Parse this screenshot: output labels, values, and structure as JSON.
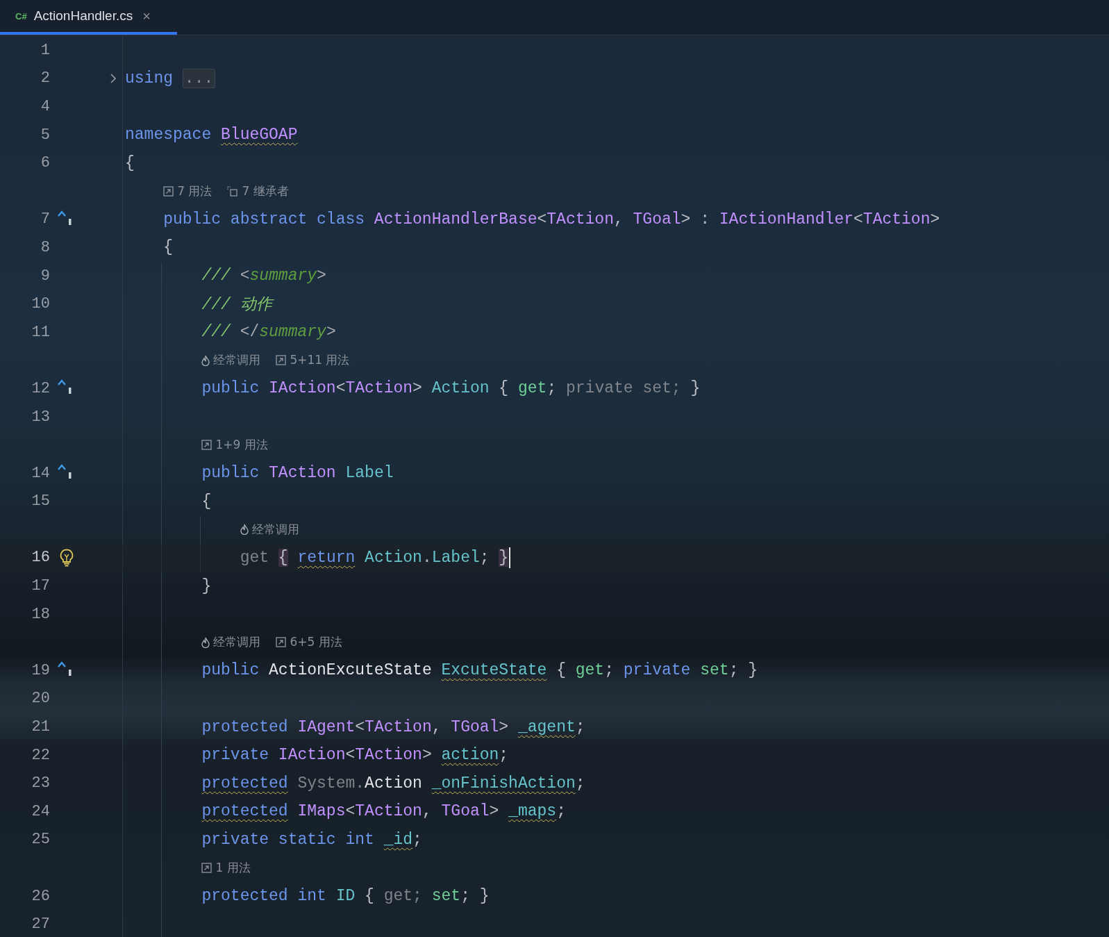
{
  "tab": {
    "badge": "C#",
    "label": "ActionHandler.cs",
    "close": "×",
    "selected": true
  },
  "lines": [
    {
      "number": "1",
      "current": false
    },
    {
      "number": "2",
      "current": false,
      "gutter": {
        "kind": "fold"
      },
      "tokens": [
        {
          "text": "using ",
          "kind": "kw"
        },
        {
          "text": "...",
          "kind": "folded"
        }
      ]
    },
    {
      "number": "4",
      "current": false
    },
    {
      "number": "5",
      "current": false,
      "tokens": [
        {
          "text": "namespace ",
          "kind": "kw"
        },
        {
          "text": "BlueGOAP",
          "kind": "type_warn"
        }
      ]
    },
    {
      "number": "6",
      "current": false,
      "tokens": [
        {
          "text": "{",
          "kind": "punct"
        }
      ]
    },
    {
      "number": "7",
      "current": false,
      "gutter": {
        "kind": "implements"
      },
      "hints": [
        {
          "kind": "usages",
          "text": "7 用法"
        },
        {
          "kind": "inheritors",
          "text": "7 继承者"
        }
      ],
      "tokens": [
        {
          "text": "    public abstract class ",
          "kind": "kw"
        },
        {
          "text": "ActionHandlerBase",
          "kind": "type"
        },
        {
          "text": "<",
          "kind": "punct"
        },
        {
          "text": "TAction",
          "kind": "type"
        },
        {
          "text": ", ",
          "kind": "punct"
        },
        {
          "text": "TGoal",
          "kind": "type"
        },
        {
          "text": "> : ",
          "kind": "punct"
        },
        {
          "text": "IActionHandler",
          "kind": "type"
        },
        {
          "text": "<",
          "kind": "punct"
        },
        {
          "text": "TAction",
          "kind": "type"
        },
        {
          "text": ">",
          "kind": "punct"
        }
      ]
    },
    {
      "number": "8",
      "current": false,
      "tokens": [
        {
          "text": "    {",
          "kind": "punct"
        }
      ]
    },
    {
      "number": "9",
      "current": false,
      "tokens": [
        {
          "text": "        /// ",
          "kind": "comment"
        },
        {
          "text": "<",
          "kind": "doc_bracket"
        },
        {
          "text": "summary",
          "kind": "doc_tag"
        },
        {
          "text": ">",
          "kind": "doc_bracket"
        }
      ]
    },
    {
      "number": "10",
      "current": false,
      "tokens": [
        {
          "text": "        /// 动作",
          "kind": "comment"
        }
      ]
    },
    {
      "number": "11",
      "current": false,
      "tokens": [
        {
          "text": "        /// ",
          "kind": "comment"
        },
        {
          "text": "</",
          "kind": "doc_bracket"
        },
        {
          "text": "summary",
          "kind": "doc_tag"
        },
        {
          "text": ">",
          "kind": "doc_bracket"
        }
      ]
    },
    {
      "number": "12",
      "current": false,
      "gutter": {
        "kind": "implements"
      },
      "hints": [
        {
          "kind": "hot",
          "text": "经常调用"
        },
        {
          "kind": "usages",
          "text": "5+11 用法"
        }
      ],
      "tokens": [
        {
          "text": "        public ",
          "kind": "kw"
        },
        {
          "text": "IAction",
          "kind": "type"
        },
        {
          "text": "<",
          "kind": "punct"
        },
        {
          "text": "TAction",
          "kind": "type"
        },
        {
          "text": "> ",
          "kind": "punct"
        },
        {
          "text": "Action",
          "kind": "prop"
        },
        {
          "text": " { ",
          "kind": "punct"
        },
        {
          "text": "get",
          "kind": "accessor"
        },
        {
          "text": "; ",
          "kind": "punct"
        },
        {
          "text": "private set;",
          "kind": "muted"
        },
        {
          "text": " }",
          "kind": "punct"
        }
      ]
    },
    {
      "number": "13",
      "current": false
    },
    {
      "number": "14",
      "current": false,
      "gutter": {
        "kind": "implements"
      },
      "hints": [
        {
          "kind": "usages",
          "text": "1+9 用法"
        }
      ],
      "tokens": [
        {
          "text": "        public ",
          "kind": "kw"
        },
        {
          "text": "TAction ",
          "kind": "type"
        },
        {
          "text": "Label",
          "kind": "prop"
        }
      ]
    },
    {
      "number": "15",
      "current": false,
      "tokens": [
        {
          "text": "        {",
          "kind": "punct"
        }
      ]
    },
    {
      "number": "16",
      "current": true,
      "gutter": {
        "kind": "bulb"
      },
      "hints": [
        {
          "kind": "hot",
          "text": "经常调用"
        }
      ],
      "tokens": [
        {
          "text": "            get ",
          "kind": "muted"
        },
        {
          "text": "{",
          "kind": "brace_match"
        },
        {
          "text": " return",
          "kind": "kw_warn"
        },
        {
          "text": " Action",
          "kind": "prop"
        },
        {
          "text": ".",
          "kind": "punct"
        },
        {
          "text": "Label",
          "kind": "prop"
        },
        {
          "text": "; ",
          "kind": "punct"
        },
        {
          "text": "}",
          "kind": "brace_match"
        }
      ]
    },
    {
      "number": "17",
      "current": false,
      "tokens": [
        {
          "text": "        }",
          "kind": "punct"
        }
      ]
    },
    {
      "number": "18",
      "current": false
    },
    {
      "number": "19",
      "current": false,
      "gutter": {
        "kind": "implements"
      },
      "hints": [
        {
          "kind": "hot",
          "text": "经常调用"
        },
        {
          "kind": "usages",
          "text": "6+5 用法"
        }
      ],
      "tokens": [
        {
          "text": "        public ",
          "kind": "kw"
        },
        {
          "text": "ActionExcuteState ",
          "kind": "plain"
        },
        {
          "text": "ExcuteState",
          "kind": "prop_warn"
        },
        {
          "text": " { ",
          "kind": "punct"
        },
        {
          "text": "get",
          "kind": "accessor"
        },
        {
          "text": "; ",
          "kind": "punct"
        },
        {
          "text": "private ",
          "kind": "kw"
        },
        {
          "text": "set",
          "kind": "accessor"
        },
        {
          "text": "; }",
          "kind": "punct"
        }
      ]
    },
    {
      "number": "20",
      "current": false
    },
    {
      "number": "21",
      "current": false,
      "tokens": [
        {
          "text": "        protected ",
          "kind": "kw"
        },
        {
          "text": "IAgent",
          "kind": "type"
        },
        {
          "text": "<",
          "kind": "punct"
        },
        {
          "text": "TAction",
          "kind": "type"
        },
        {
          "text": ", ",
          "kind": "punct"
        },
        {
          "text": "TGoal",
          "kind": "type"
        },
        {
          "text": "> ",
          "kind": "punct"
        },
        {
          "text": "_agent",
          "kind": "prop_warn"
        },
        {
          "text": ";",
          "kind": "punct"
        }
      ]
    },
    {
      "number": "22",
      "current": false,
      "tokens": [
        {
          "text": "        private ",
          "kind": "kw"
        },
        {
          "text": "IAction",
          "kind": "type"
        },
        {
          "text": "<",
          "kind": "punct"
        },
        {
          "text": "TAction",
          "kind": "type"
        },
        {
          "text": "> ",
          "kind": "punct"
        },
        {
          "text": "action",
          "kind": "prop_warn"
        },
        {
          "text": ";",
          "kind": "punct"
        }
      ]
    },
    {
      "number": "23",
      "current": false,
      "tokens": [
        {
          "text": "        protected",
          "kind": "kw_warn"
        },
        {
          "text": " System.",
          "kind": "muted"
        },
        {
          "text": "Action ",
          "kind": "plain"
        },
        {
          "text": "_onFinishAction",
          "kind": "prop_warn"
        },
        {
          "text": ";",
          "kind": "punct"
        }
      ]
    },
    {
      "number": "24",
      "current": false,
      "tokens": [
        {
          "text": "        protected",
          "kind": "kw_warn"
        },
        {
          "text": " IMaps",
          "kind": "type"
        },
        {
          "text": "<",
          "kind": "punct"
        },
        {
          "text": "TAction",
          "kind": "type"
        },
        {
          "text": ", ",
          "kind": "punct"
        },
        {
          "text": "TGoal",
          "kind": "type"
        },
        {
          "text": "> ",
          "kind": "punct"
        },
        {
          "text": "_maps",
          "kind": "prop_warn"
        },
        {
          "text": ";",
          "kind": "punct"
        }
      ]
    },
    {
      "number": "25",
      "current": false,
      "tokens": [
        {
          "text": "        private static int ",
          "kind": "kw"
        },
        {
          "text": "_id",
          "kind": "prop_warn"
        },
        {
          "text": ";",
          "kind": "punct"
        }
      ]
    },
    {
      "number": "26",
      "current": false,
      "hints": [
        {
          "kind": "usages",
          "text": "1 用法"
        }
      ],
      "tokens": [
        {
          "text": "        protected int ",
          "kind": "kw"
        },
        {
          "text": "ID",
          "kind": "prop"
        },
        {
          "text": " { ",
          "kind": "punct"
        },
        {
          "text": "get;",
          "kind": "muted"
        },
        {
          "text": " set",
          "kind": "accessor"
        },
        {
          "text": "; }",
          "kind": "punct"
        }
      ]
    },
    {
      "number": "27",
      "current": false
    }
  ]
}
